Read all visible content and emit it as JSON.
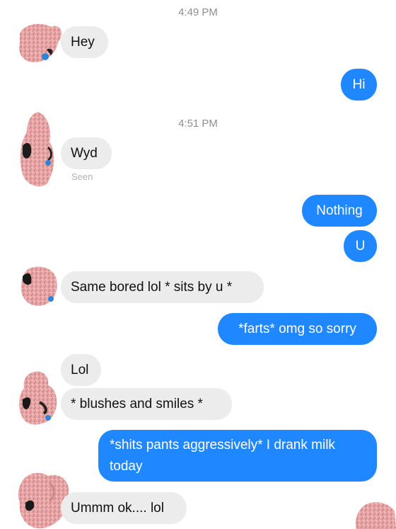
{
  "timestamps": [
    "4:49 PM",
    "4:51 PM"
  ],
  "messages": [
    {
      "from": "them",
      "text": "Hey"
    },
    {
      "from": "me",
      "text": "Hi"
    },
    {
      "from": "them",
      "text": "Wyd"
    },
    {
      "from": "me",
      "text": "Nothing"
    },
    {
      "from": "me",
      "text": "U"
    },
    {
      "from": "them",
      "text": "Same bored lol * sits by u *"
    },
    {
      "from": "me",
      "text": "*farts* omg so sorry"
    },
    {
      "from": "them",
      "text": "Lol"
    },
    {
      "from": "them",
      "text": "* blushes and smiles *"
    },
    {
      "from": "me",
      "text": "*shits pants aggressively* I drank milk today"
    },
    {
      "from": "them",
      "text": "Ummm ok.... lol"
    }
  ],
  "read_receipt": "Seen",
  "colors": {
    "outgoing_bubble": "#1f87ff",
    "incoming_bubble": "#ececec",
    "background": "#ffffff",
    "timestamp_text": "#8e8e93",
    "avatar_scribble": "#e8a6a6"
  },
  "icons": [
    "scribbled-avatar-icon"
  ]
}
